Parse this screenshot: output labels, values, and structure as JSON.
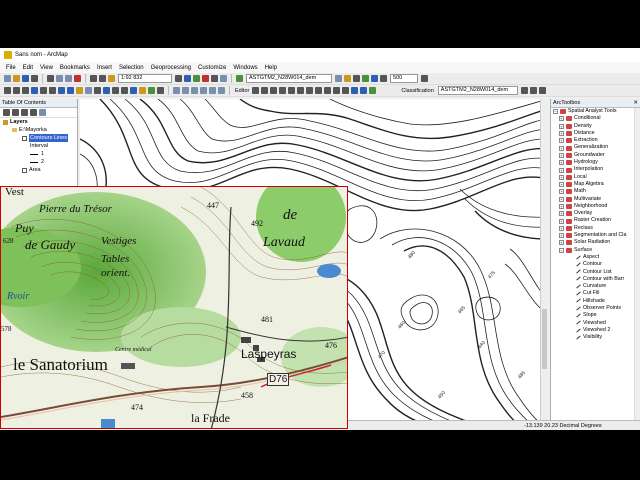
{
  "window": {
    "title": "Sans nom - ArcMap"
  },
  "menu": [
    "File",
    "Edit",
    "View",
    "Bookmarks",
    "Insert",
    "Selection",
    "Geoprocessing",
    "Customize",
    "Windows",
    "Help"
  ],
  "toolbar": {
    "scale": "1:92 832",
    "layer_combo": "ASTGTM2_N28W014_dem",
    "layer_combo2": "ASTGTM2_N28W014_dem",
    "zoom_value": "500",
    "editor": "Editor",
    "classification": "Classification"
  },
  "toc": {
    "title": "Table Of Contents",
    "rows": [
      "Layers",
      "E:\\Mayorka",
      "Contours Lines",
      "Interval",
      "1",
      "2",
      "Area"
    ]
  },
  "toolbox": {
    "title": "ArcToolbox",
    "root": "Spatial Analyst Tools",
    "items": [
      "Conditional",
      "Density",
      "Distance",
      "Extraction",
      "Generalization",
      "Groundwater",
      "Hydrology",
      "Interpolation",
      "Local",
      "Map Algebra",
      "Math",
      "Multivariate",
      "Neighborhood",
      "Overlay",
      "Raster Creation",
      "Reclass",
      "Segmentation and Cla",
      "Solar Radiation",
      "Surface"
    ],
    "surface_tools": [
      "Aspect",
      "Contour",
      "Contour List",
      "Contour with Barr",
      "Curvature",
      "Cut Fill",
      "Hillshade",
      "Observer Points",
      "Slope",
      "Viewshed",
      "Viewshed 2",
      "Visibility"
    ]
  },
  "status": {
    "coords": "-13.139  20.23 Decimal Degrees"
  },
  "topo": {
    "labels": [
      "Vest",
      "Pierre du Trésor",
      "Puy",
      "de Gaudy",
      "Vestiges",
      "Tables",
      "orient.",
      "Rvoir",
      "le Sanatorium",
      "Laspeyras",
      "la Frade",
      "de",
      "Lavaud",
      "447",
      "492",
      "481",
      "476",
      "458",
      "474",
      "D76",
      "628",
      "578",
      "Centre médical"
    ]
  },
  "contour_labels": [
    "470",
    "460",
    "450",
    "440",
    "480",
    "475",
    "490",
    "485",
    "465"
  ]
}
